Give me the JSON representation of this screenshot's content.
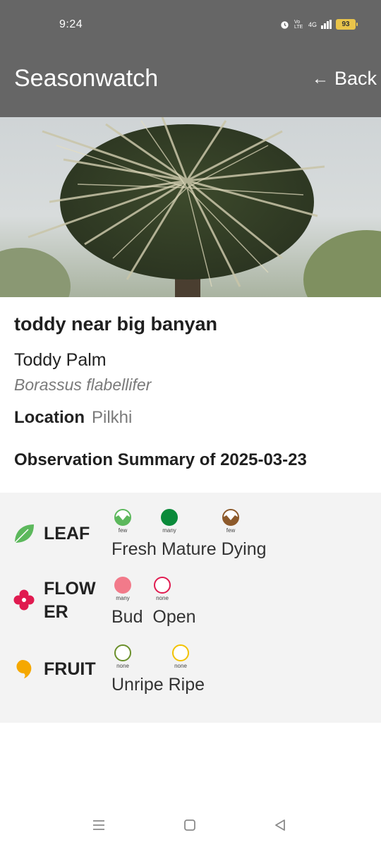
{
  "status_bar": {
    "time": "9:24",
    "network": "4G",
    "volte": "Vo LTE",
    "battery": "93"
  },
  "app_bar": {
    "title": "Seasonwatch",
    "back_label": "Back"
  },
  "tree": {
    "nickname": "toddy near big banyan",
    "common_name": "Toddy Palm",
    "scientific_name": "Borassus flabellifer",
    "location_label": "Location",
    "location_value": "Pilkhi",
    "observation_title": "Observation Summary of 2025-03-23"
  },
  "summary": {
    "leaf": {
      "label": "LEAF",
      "stages": [
        {
          "name": "Fresh",
          "amount": "few"
        },
        {
          "name": "Mature",
          "amount": "many"
        },
        {
          "name": "Dying",
          "amount": "few"
        }
      ],
      "stage_text": "Fresh Mature Dying"
    },
    "flower": {
      "label_line1": "FLOW",
      "label_line2": "ER",
      "stages": [
        {
          "name": "Bud",
          "amount": "many"
        },
        {
          "name": "Open",
          "amount": "none"
        }
      ],
      "stage_text": "Bud  Open"
    },
    "fruit": {
      "label": "FRUIT",
      "stages": [
        {
          "name": "Unripe",
          "amount": "none"
        },
        {
          "name": "Ripe",
          "amount": "none"
        }
      ],
      "stage_text": "Unripe Ripe"
    }
  },
  "colors": {
    "app_bar": "#666666",
    "leaf_green": "#4caf50",
    "leaf_dark": "#0a8a3a",
    "dying_brown": "#8d5a2b",
    "bud_pink": "#f27a8a",
    "flower_red": "#e01a4f",
    "unripe_green": "#6a8f2a",
    "ripe_yellow": "#f2c200",
    "fruit_orange": "#f5a800"
  },
  "icons": {
    "back": "arrow-left-icon",
    "nav_recents": "menu-icon",
    "nav_home": "square-icon",
    "nav_back": "triangle-back-icon"
  }
}
